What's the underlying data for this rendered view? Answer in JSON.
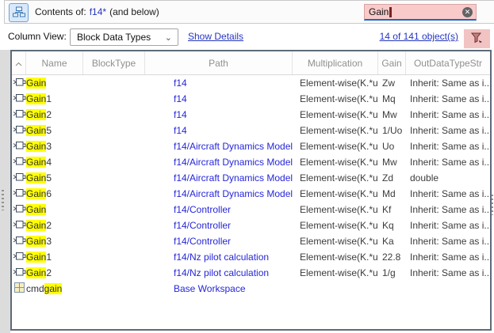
{
  "header": {
    "title_label": "Contents of:",
    "title_value": "f14*",
    "title_suffix": "(and below)",
    "search": {
      "value": "Gain"
    }
  },
  "toolbar": {
    "column_view_label": "Column View:",
    "column_view_value": "Block Data Types",
    "show_details_label": "Show Details",
    "count_link": "14 of 141 object(s)"
  },
  "table": {
    "columns": [
      "Name",
      "BlockType",
      "Path",
      "Multiplication",
      "Gain",
      "OutDataTypeStr"
    ],
    "rows": [
      {
        "icon": "block",
        "name_pre": "",
        "name_match": "Gain",
        "name_post": "",
        "block_type": "",
        "path": "f14",
        "multiplication": "Element-wise(K.*u)",
        "gain": "Zw",
        "out_data_type_str": "Inherit: Same as i..."
      },
      {
        "icon": "block",
        "name_pre": "",
        "name_match": "Gain",
        "name_post": "1",
        "block_type": "",
        "path": "f14",
        "multiplication": "Element-wise(K.*u)",
        "gain": "Mq",
        "out_data_type_str": "Inherit: Same as i..."
      },
      {
        "icon": "block",
        "name_pre": "",
        "name_match": "Gain",
        "name_post": "2",
        "block_type": "",
        "path": "f14",
        "multiplication": "Element-wise(K.*u)",
        "gain": "Mw",
        "out_data_type_str": "Inherit: Same as i..."
      },
      {
        "icon": "block",
        "name_pre": "",
        "name_match": "Gain",
        "name_post": "5",
        "block_type": "",
        "path": "f14",
        "multiplication": "Element-wise(K.*u)",
        "gain": "1/Uo",
        "out_data_type_str": "Inherit: Same as i..."
      },
      {
        "icon": "block",
        "name_pre": "",
        "name_match": "Gain",
        "name_post": "3",
        "block_type": "",
        "path": "f14/Aircraft Dynamics Model",
        "multiplication": "Element-wise(K.*u)",
        "gain": "Uo",
        "out_data_type_str": "Inherit: Same as i..."
      },
      {
        "icon": "block",
        "name_pre": "",
        "name_match": "Gain",
        "name_post": "4",
        "block_type": "",
        "path": "f14/Aircraft Dynamics Model",
        "multiplication": "Element-wise(K.*u)",
        "gain": "Mw",
        "out_data_type_str": "Inherit: Same as i..."
      },
      {
        "icon": "block",
        "name_pre": "",
        "name_match": "Gain",
        "name_post": "5",
        "block_type": "",
        "path": "f14/Aircraft Dynamics Model",
        "multiplication": "Element-wise(K.*u)",
        "gain": "Zd",
        "out_data_type_str": "double"
      },
      {
        "icon": "block",
        "name_pre": "",
        "name_match": "Gain",
        "name_post": "6",
        "block_type": "",
        "path": "f14/Aircraft Dynamics Model",
        "multiplication": "Element-wise(K.*u)",
        "gain": "Md",
        "out_data_type_str": "Inherit: Same as i..."
      },
      {
        "icon": "block",
        "name_pre": "",
        "name_match": "Gain",
        "name_post": "",
        "block_type": "",
        "path": "f14/Controller",
        "multiplication": "Element-wise(K.*u)",
        "gain": "Kf",
        "out_data_type_str": "Inherit: Same as i..."
      },
      {
        "icon": "block",
        "name_pre": "",
        "name_match": "Gain",
        "name_post": "2",
        "block_type": "",
        "path": "f14/Controller",
        "multiplication": "Element-wise(K.*u)",
        "gain": "Kq",
        "out_data_type_str": "Inherit: Same as i..."
      },
      {
        "icon": "block",
        "name_pre": "",
        "name_match": "Gain",
        "name_post": "3",
        "block_type": "",
        "path": "f14/Controller",
        "multiplication": "Element-wise(K.*u)",
        "gain": "Ka",
        "out_data_type_str": "Inherit: Same as i..."
      },
      {
        "icon": "block",
        "name_pre": "",
        "name_match": "Gain",
        "name_post": "1",
        "block_type": "",
        "path": "f14/Nz pilot calculation",
        "multiplication": "Element-wise(K.*u)",
        "gain": "22.8",
        "out_data_type_str": "Inherit: Same as i..."
      },
      {
        "icon": "block",
        "name_pre": "",
        "name_match": "Gain",
        "name_post": "2",
        "block_type": "",
        "path": "f14/Nz pilot calculation",
        "multiplication": "Element-wise(K.*u)",
        "gain": "1/g",
        "out_data_type_str": "Inherit: Same as i..."
      },
      {
        "icon": "variable",
        "name_pre": "cmd",
        "name_match": "gain",
        "name_post": "",
        "block_type": "",
        "path": "Base Workspace",
        "multiplication": "",
        "gain": "",
        "out_data_type_str": ""
      }
    ]
  },
  "icons": {
    "header_button": "hierarchy-icon",
    "search_clear": "close-circle-icon",
    "dropdown": "chevron-down-icon",
    "filter": "funnel-icon",
    "sort": "sort-ascending-icon",
    "row_block": "simulink-block-icon",
    "row_variable": "workspace-variable-icon"
  },
  "colors": {
    "hl": "#ffff00",
    "search-bg": "#f8caca",
    "search-underline": "#1868c9",
    "link-dark": "#2535c0",
    "path-link": "#2626d9",
    "filter-bg": "#f2c3c3",
    "icon-blue": "#3c78b4",
    "funnel": "#8b4040"
  }
}
